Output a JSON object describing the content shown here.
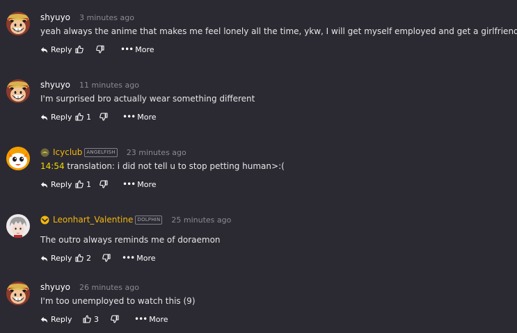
{
  "comments": [
    {
      "username": "shyuyo",
      "time_ago": "3 minutes ago",
      "text": "yeah always the anime that makes me feel lonely all the time, ykw, I will get myself employed and get a girlfriend.",
      "reply_label": "Reply",
      "likes": "",
      "more_label": "More",
      "avatar": "luffy-avatar"
    },
    {
      "username": "shyuyo",
      "time_ago": "11 minutes ago",
      "text": "I'm surprised bro actually wear something different",
      "reply_label": "Reply",
      "likes": "1",
      "more_label": "More",
      "avatar": "luffy-avatar"
    },
    {
      "username": "Icyclub",
      "badge": "ANGELFISH",
      "time_ago": "23 minutes ago",
      "timestamp": "14:54",
      "text": " translation: i did not tell u to stop petting human>:(",
      "reply_label": "Reply",
      "likes": "1",
      "more_label": "More",
      "avatar": "orange-mascot-avatar"
    },
    {
      "username": "Leonhart_Valentine",
      "badge": "DOLPHIN",
      "time_ago": "25 minutes ago",
      "text": "The outro always reminds me of doraemon",
      "reply_label": "Reply",
      "likes": "2",
      "more_label": "More",
      "avatar": "silver-hair-avatar"
    },
    {
      "username": "shyuyo",
      "time_ago": "26 minutes ago",
      "text": "I'm too unemployed to watch this (9)",
      "reply_label": "Reply",
      "likes": "3",
      "more_label": "More",
      "avatar": "luffy-avatar"
    }
  ],
  "colors": {
    "background": "#2b2a33",
    "gold_username": "#f5b70a",
    "timestamp": "#f5d800",
    "muted": "#8a8a93"
  }
}
